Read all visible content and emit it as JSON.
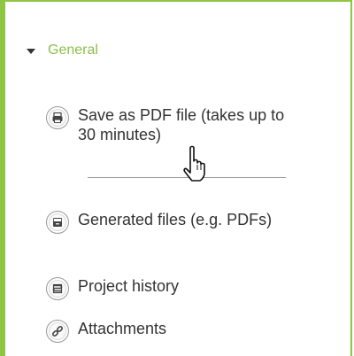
{
  "section": {
    "title": "General"
  },
  "items": [
    {
      "label": "Save as PDF file (takes up to 30 minutes)",
      "icon": "printer-icon"
    },
    {
      "label": "Generated files (e.g. PDFs)",
      "icon": "file-drawer-icon"
    },
    {
      "label": "Project history",
      "icon": "history-icon"
    },
    {
      "label": "Attachments",
      "icon": "link-icon"
    }
  ],
  "colors": {
    "accent": "#8fc641",
    "section_title": "#8bbf4a",
    "text": "#333333"
  }
}
